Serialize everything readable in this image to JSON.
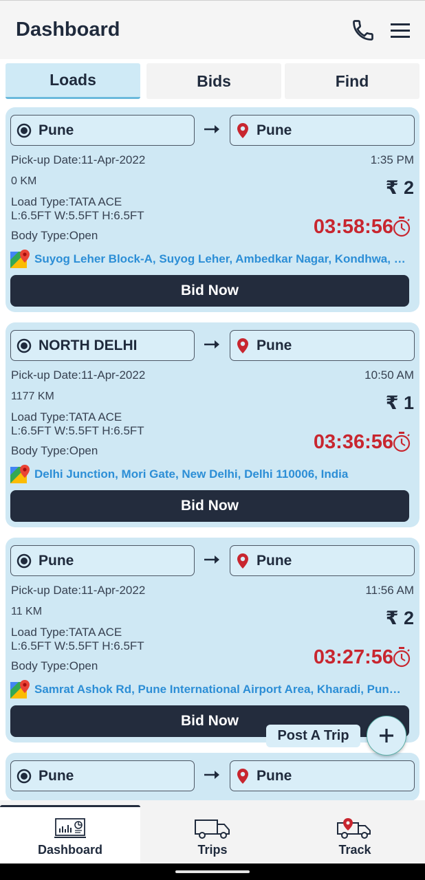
{
  "header": {
    "title": "Dashboard",
    "icons": [
      "phone-icon",
      "menu-icon"
    ]
  },
  "tabs": [
    {
      "label": "Loads",
      "active": true
    },
    {
      "label": "Bids",
      "active": false
    },
    {
      "label": "Find",
      "active": false
    }
  ],
  "loads": [
    {
      "from": "Pune",
      "to": "Pune",
      "pickup": "Pick-up Date:11-Apr-2022",
      "time": "1:35 PM",
      "distance": "0 KM",
      "price": "₹ 2",
      "load_type": "Load Type:TATA ACE",
      "dimensions": "L:6.5FT W:5.5FT H:6.5FT",
      "body_type": "Body Type:Open",
      "timer": "03:58:56",
      "address": "Suyog Leher Block-A, Suyog Leher, Ambedkar Nagar, Kondhwa, P...",
      "button": "Bid Now"
    },
    {
      "from": "NORTH DELHI",
      "to": "Pune",
      "pickup": "Pick-up Date:11-Apr-2022",
      "time": "10:50 AM",
      "distance": "1177 KM",
      "price": "₹ 1",
      "load_type": "Load Type:TATA ACE",
      "dimensions": "L:6.5FT W:5.5FT H:6.5FT",
      "body_type": "Body Type:Open",
      "timer": "03:36:56",
      "address": "Delhi Junction, Mori Gate, New Delhi, Delhi 110006, India",
      "button": "Bid Now"
    },
    {
      "from": "Pune",
      "to": "Pune",
      "pickup": "Pick-up Date:11-Apr-2022",
      "time": "11:56 AM",
      "distance": "11 KM",
      "price": "₹ 2",
      "load_type": "Load Type:TATA ACE",
      "dimensions": "L:6.5FT W:5.5FT H:6.5FT",
      "body_type": "Body Type:Open",
      "timer": "03:27:56",
      "address": "Samrat Ashok Rd, Pune International Airport Area, Kharadi, Pune,...",
      "button": "Bid Now"
    },
    {
      "from": "Pune",
      "to": "Pune"
    }
  ],
  "fab": {
    "label": "Post A Trip",
    "icon": "plus-icon"
  },
  "bottom_nav": [
    {
      "label": "Dashboard",
      "icon": "dashboard-icon",
      "active": true
    },
    {
      "label": "Trips",
      "icon": "truck-icon",
      "active": false
    },
    {
      "label": "Track",
      "icon": "track-truck-icon",
      "active": false
    }
  ],
  "colors": {
    "card_bg": "#cfe8f4",
    "button_bg": "#232c3d",
    "timer": "#c8262f",
    "address": "#2c8ed6"
  }
}
